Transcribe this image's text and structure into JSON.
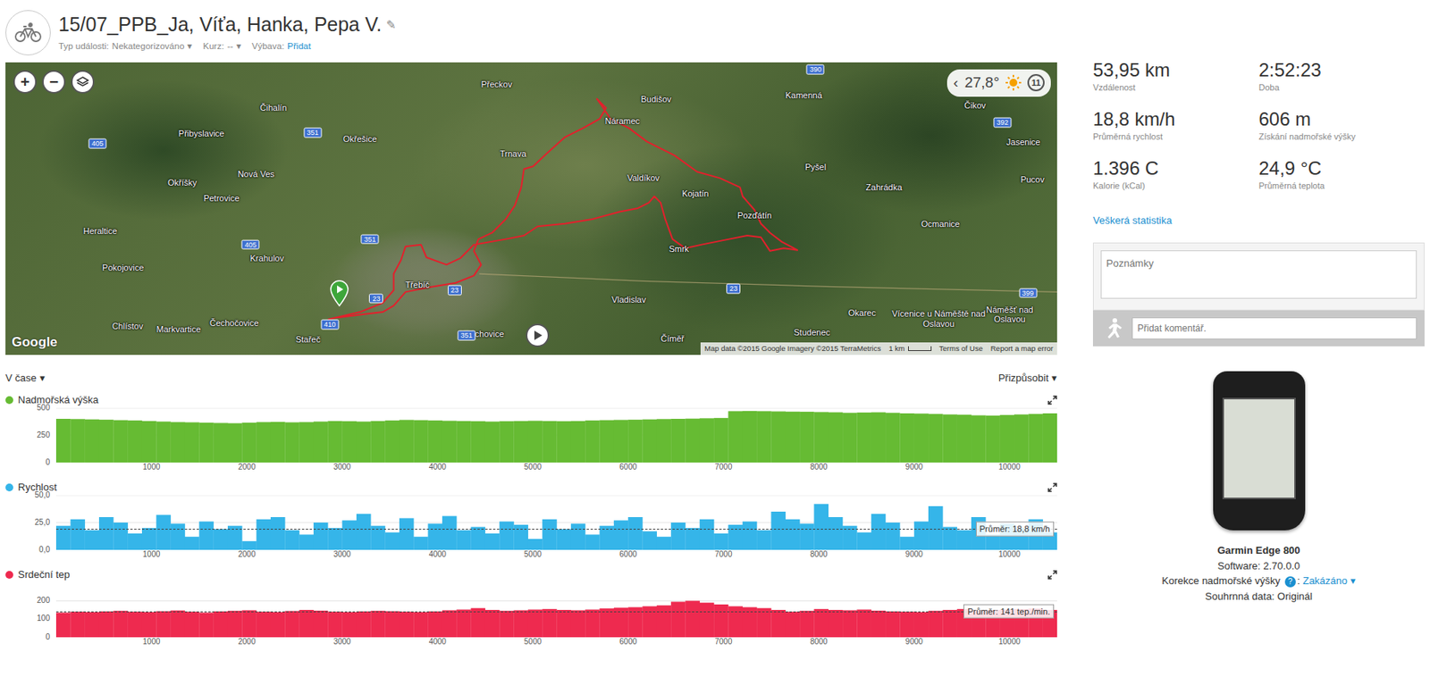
{
  "activity": {
    "title": "15/07_PPB_Ja, Víťa, Hanka, Pepa V.",
    "edit_icon": "✎",
    "meta": [
      {
        "label": "Typ události:",
        "value": "Nekategorizováno",
        "arrow": "▾",
        "kind": "dropdown"
      },
      {
        "label": "Kurz:",
        "value": "--",
        "arrow": "▾",
        "kind": "dropdown"
      },
      {
        "label": "Výbava:",
        "value": "Přidat",
        "arrow": "",
        "kind": "link"
      }
    ]
  },
  "map": {
    "zoom_in": "+",
    "zoom_out": "−",
    "weather": {
      "prev": "‹",
      "temp": "27,8°",
      "count": "11"
    },
    "brand": "Google",
    "attribution": "Map data ©2015 Google Imagery ©2015 TerraMetrics",
    "scale": "1 km",
    "links": [
      "Terms of Use",
      "Report a map error"
    ],
    "places": [
      "Přeckov",
      "Budišov",
      "Kamenná",
      "Čikov",
      "Čihalín",
      "Přibyslavice",
      "Okřešice",
      "Náramec",
      "Jasenice",
      "Trnava",
      "Valdíkov",
      "Pyšel",
      "Nová Ves",
      "Okříšky",
      "Petrovice",
      "Kojatín",
      "Zahrádka",
      "Pucov",
      "Pozďátín",
      "Ocmanice",
      "Heraltice",
      "Krahulov",
      "Smrk",
      "Pokojovice",
      "Třebíč",
      "Vladislav",
      "Okarec",
      "Studenec",
      "Chlístov",
      "Markvartice",
      "Čechočovice",
      "Kožichovice",
      "Číměř",
      "Stařeč",
      "Vícenice u Náměště nad Oslavou",
      "Náměšť nad Oslavou"
    ],
    "roads": [
      "390",
      "392",
      "405",
      "351",
      "405",
      "351",
      "23",
      "23",
      "410",
      "351",
      "23",
      "399"
    ]
  },
  "charts": {
    "mode": {
      "label": "V čase",
      "arrow": "▾"
    },
    "fit": {
      "label": "Přizpůsobit",
      "arrow": "▾"
    },
    "x_ticks": [
      {
        "label": "1000",
        "value": 1000
      },
      {
        "label": "2000",
        "value": 2000
      },
      {
        "label": "3000",
        "value": 3000
      },
      {
        "label": "4000",
        "value": 4000
      },
      {
        "label": "5000",
        "value": 5000
      },
      {
        "label": "6000",
        "value": 6000
      },
      {
        "label": "7000",
        "value": 7000
      },
      {
        "label": "8000",
        "value": 8000
      },
      {
        "label": "9000",
        "value": 9000
      },
      {
        "label": "10000",
        "value": 10000
      }
    ],
    "series": [
      {
        "name": "Nadmořská výška",
        "color": "#66bb33",
        "max": 500,
        "y_ticks": [
          {
            "label": "500",
            "value": 500
          },
          {
            "label": "250",
            "value": 250
          },
          {
            "label": "0",
            "value": 0
          }
        ],
        "values": [
          400,
          398,
          395,
          392,
          388,
          385,
          380,
          375,
          370,
          368,
          365,
          362,
          360,
          365,
          370,
          372,
          368,
          370,
          375,
          380,
          378,
          375,
          380,
          385,
          390,
          388,
          385,
          382,
          380,
          378,
          375,
          378,
          380,
          382,
          380,
          378,
          380,
          385,
          388,
          390,
          392,
          395,
          398,
          400,
          402,
          405,
          408,
          470,
          472,
          470,
          468,
          466,
          465,
          462,
          460,
          455,
          458,
          460,
          455,
          450,
          448,
          445,
          440,
          438,
          432,
          430,
          435,
          440,
          445,
          450
        ]
      },
      {
        "name": "Rychlost",
        "color": "#35b5e9",
        "max": 50,
        "y_ticks": [
          {
            "label": "50,0",
            "value": 50
          },
          {
            "label": "25,0",
            "value": 25
          },
          {
            "label": "0,0",
            "value": 0
          }
        ],
        "values": [
          22,
          28,
          18,
          30,
          25,
          15,
          20,
          32,
          24,
          12,
          26,
          19,
          22,
          8,
          28,
          30,
          18,
          14,
          25,
          20,
          27,
          33,
          22,
          16,
          29,
          12,
          24,
          31,
          18,
          21,
          15,
          26,
          23,
          10,
          28,
          19,
          24,
          14,
          22,
          27,
          30,
          17,
          12,
          25,
          20,
          28,
          15,
          23,
          26,
          18,
          35,
          28,
          24,
          42,
          30,
          22,
          16,
          33,
          25,
          12,
          26,
          40,
          21,
          18,
          30,
          14,
          24,
          20,
          28,
          16
        ],
        "average": 18.8,
        "average_label": "Průměr: 18,8 km/h"
      },
      {
        "name": "Srdeční tep",
        "color": "#ee2a4f",
        "max": 300,
        "y_ticks": [
          {
            "label": "200",
            "value": 200
          },
          {
            "label": "100",
            "value": 100
          },
          {
            "label": "0",
            "value": 0
          }
        ],
        "values": [
          135,
          140,
          138,
          142,
          145,
          140,
          138,
          143,
          147,
          140,
          135,
          142,
          145,
          148,
          140,
          138,
          144,
          150,
          146,
          140,
          138,
          142,
          145,
          143,
          140,
          138,
          142,
          148,
          152,
          160,
          150,
          145,
          148,
          152,
          155,
          150,
          148,
          152,
          158,
          162,
          165,
          170,
          175,
          195,
          200,
          190,
          180,
          170,
          165,
          160,
          150,
          140,
          145,
          155,
          150,
          148,
          152,
          146,
          142,
          140,
          138,
          145,
          150,
          155,
          148,
          150,
          152,
          155,
          158,
          150
        ],
        "average": 141,
        "average_label": "Průměr: 141 tep./min."
      }
    ]
  },
  "stats": [
    {
      "value": "53,95 km",
      "label": "Vzdálenost"
    },
    {
      "value": "2:52:23",
      "label": "Doba"
    },
    {
      "value": "18,8 km/h",
      "label": "Průměrná rychlost"
    },
    {
      "value": "606 m",
      "label": "Získání nadmořské výšky"
    },
    {
      "value": "1.396 C",
      "label": "Kalorie (kCal)"
    },
    {
      "value": "24,9 °C",
      "label": "Průměrná teplota"
    }
  ],
  "all_stats": "Veškerá statistika",
  "notes": {
    "placeholder": "Poznámky"
  },
  "comment": {
    "placeholder": "Přidat komentář."
  },
  "device": {
    "name": "Garmin Edge 800",
    "software": "Software: 2.70.0.0",
    "elevation_correction": {
      "label": "Korekce nadmořské výšky",
      "info": "?",
      "separator": ":",
      "value": "Zakázáno",
      "arrow": "▾"
    },
    "summary": "Souhrnná data: Originál"
  }
}
